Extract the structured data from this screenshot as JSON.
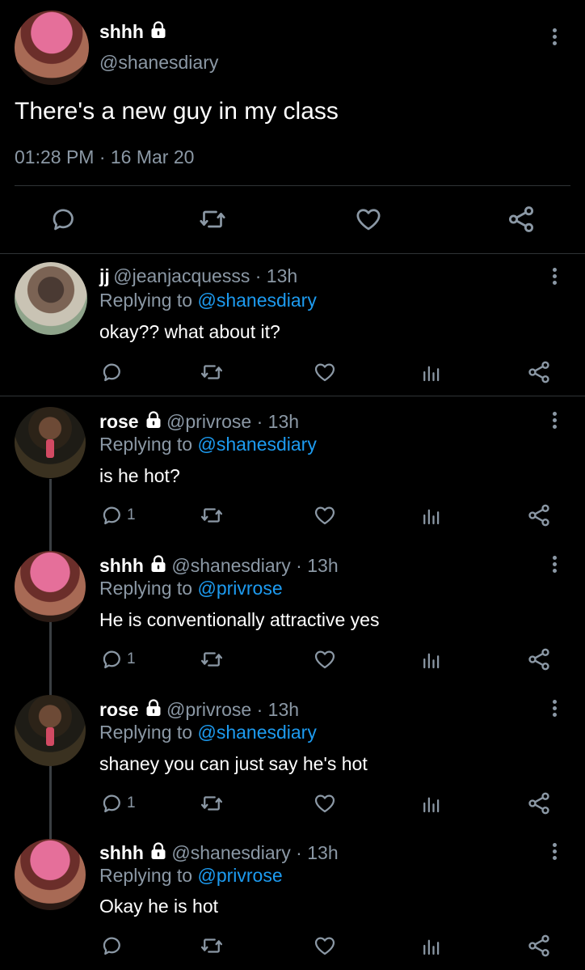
{
  "main_tweet": {
    "name": "shhh",
    "handle": "@shanesdiary",
    "text": "There's a new guy in my class",
    "timestamp": "01:28 PM · 16 Mar 20"
  },
  "replies": [
    {
      "name": "jj",
      "handle": "@jeanjacquesss",
      "time": "13h",
      "replying_prefix": "Replying to ",
      "replying_to": "@shanesdiary",
      "text": "okay?? what about it?",
      "reply_count": ""
    },
    {
      "name": "rose",
      "handle": "@privrose",
      "time": "13h",
      "replying_prefix": "Replying to ",
      "replying_to": "@shanesdiary",
      "text": "is he hot?",
      "reply_count": "1"
    },
    {
      "name": "shhh",
      "handle": "@shanesdiary",
      "time": "13h",
      "replying_prefix": "Replying to ",
      "replying_to": "@privrose",
      "text": "He is conventionally attractive yes",
      "reply_count": "1"
    },
    {
      "name": "rose",
      "handle": "@privrose",
      "time": "13h",
      "replying_prefix": "Replying to ",
      "replying_to": "@shanesdiary",
      "text": "shaney you can just say he's hot",
      "reply_count": "1"
    },
    {
      "name": "shhh",
      "handle": "@shanesdiary",
      "time": "13h",
      "replying_prefix": "Replying to ",
      "replying_to": "@privrose",
      "text": "Okay he is hot",
      "reply_count": ""
    }
  ],
  "separator": " · ",
  "icons": {
    "reply": "reply-icon",
    "retweet": "retweet-icon",
    "like": "heart-icon",
    "analytics": "analytics-icon",
    "share": "share-icon",
    "menu": "more-vertical-icon",
    "lock": "lock-icon"
  },
  "colors": {
    "background": "#000000",
    "secondary_text": "#8b98a5",
    "link": "#1d9bf0",
    "divider": "#2f3336"
  }
}
